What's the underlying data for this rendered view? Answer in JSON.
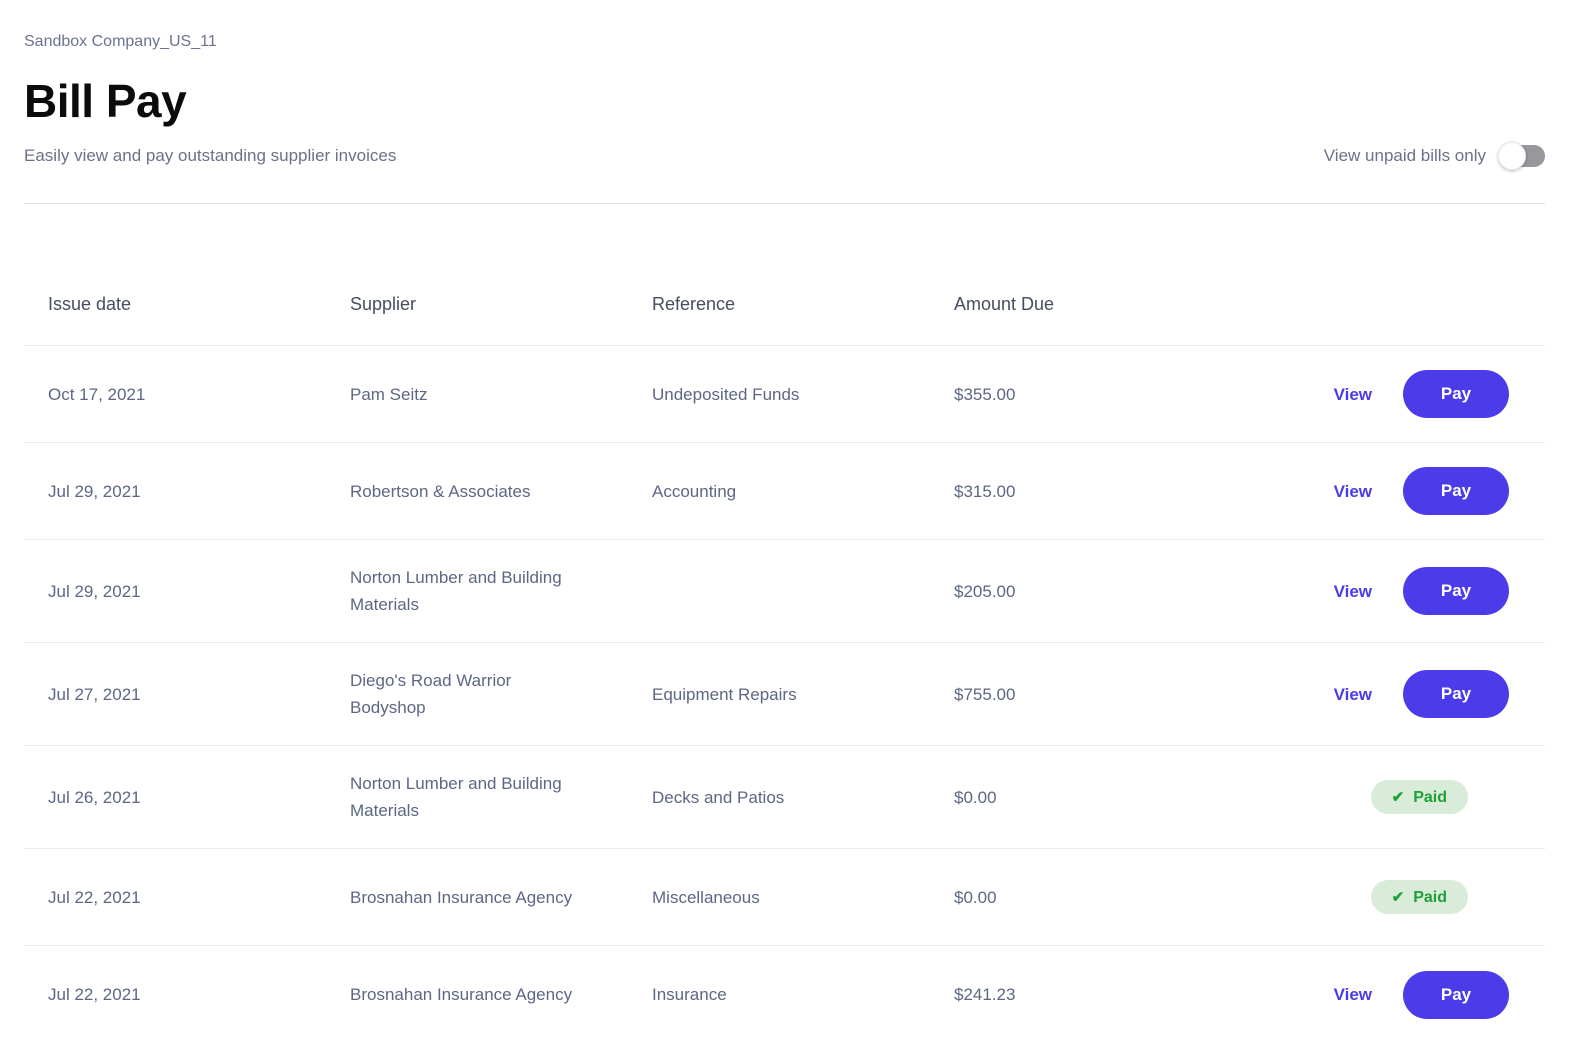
{
  "header": {
    "company": "Sandbox Company_US_11",
    "title": "Bill Pay",
    "subtitle": "Easily view and pay outstanding supplier invoices",
    "toggle_label": "View unpaid bills only",
    "toggle_state": "off"
  },
  "table": {
    "headers": [
      "Issue date",
      "Supplier",
      "Reference",
      "Amount Due"
    ],
    "rows": [
      {
        "issue_date": "Oct 17, 2021",
        "supplier": "Pam Seitz",
        "reference": "Undeposited Funds",
        "amount_due": "$355.00",
        "status": "unpaid",
        "view_label": "View",
        "pay_label": "Pay"
      },
      {
        "issue_date": "Jul 29, 2021",
        "supplier": "Robertson & Associates",
        "reference": "Accounting",
        "amount_due": "$315.00",
        "status": "unpaid",
        "view_label": "View",
        "pay_label": "Pay"
      },
      {
        "issue_date": "Jul 29, 2021",
        "supplier": "Norton Lumber and Building Materials",
        "reference": "",
        "amount_due": "$205.00",
        "status": "unpaid",
        "view_label": "View",
        "pay_label": "Pay"
      },
      {
        "issue_date": "Jul 27, 2021",
        "supplier": "Diego's Road Warrior Bodyshop",
        "reference": "Equipment Repairs",
        "amount_due": "$755.00",
        "status": "unpaid",
        "view_label": "View",
        "pay_label": "Pay"
      },
      {
        "issue_date": "Jul 26, 2021",
        "supplier": "Norton Lumber and Building Materials",
        "reference": "Decks and Patios",
        "amount_due": "$0.00",
        "status": "paid",
        "paid_label": "Paid"
      },
      {
        "issue_date": "Jul 22, 2021",
        "supplier": "Brosnahan Insurance Agency",
        "reference": "Miscellaneous",
        "amount_due": "$0.00",
        "status": "paid",
        "paid_label": "Paid"
      },
      {
        "issue_date": "Jul 22, 2021",
        "supplier": "Brosnahan Insurance Agency",
        "reference": "Insurance",
        "amount_due": "$241.23",
        "status": "unpaid",
        "view_label": "View",
        "pay_label": "Pay"
      }
    ]
  },
  "icons": {
    "check": "✔"
  },
  "colors": {
    "accent_indigo": "#4B3BE8",
    "paid_green": "#21A038",
    "paid_badge_bg": "#D9ECD9",
    "toggle_track": "#98979C",
    "text_muted": "#6A7288",
    "text_cell": "#5D6783",
    "divider": "#E3E3E3"
  }
}
